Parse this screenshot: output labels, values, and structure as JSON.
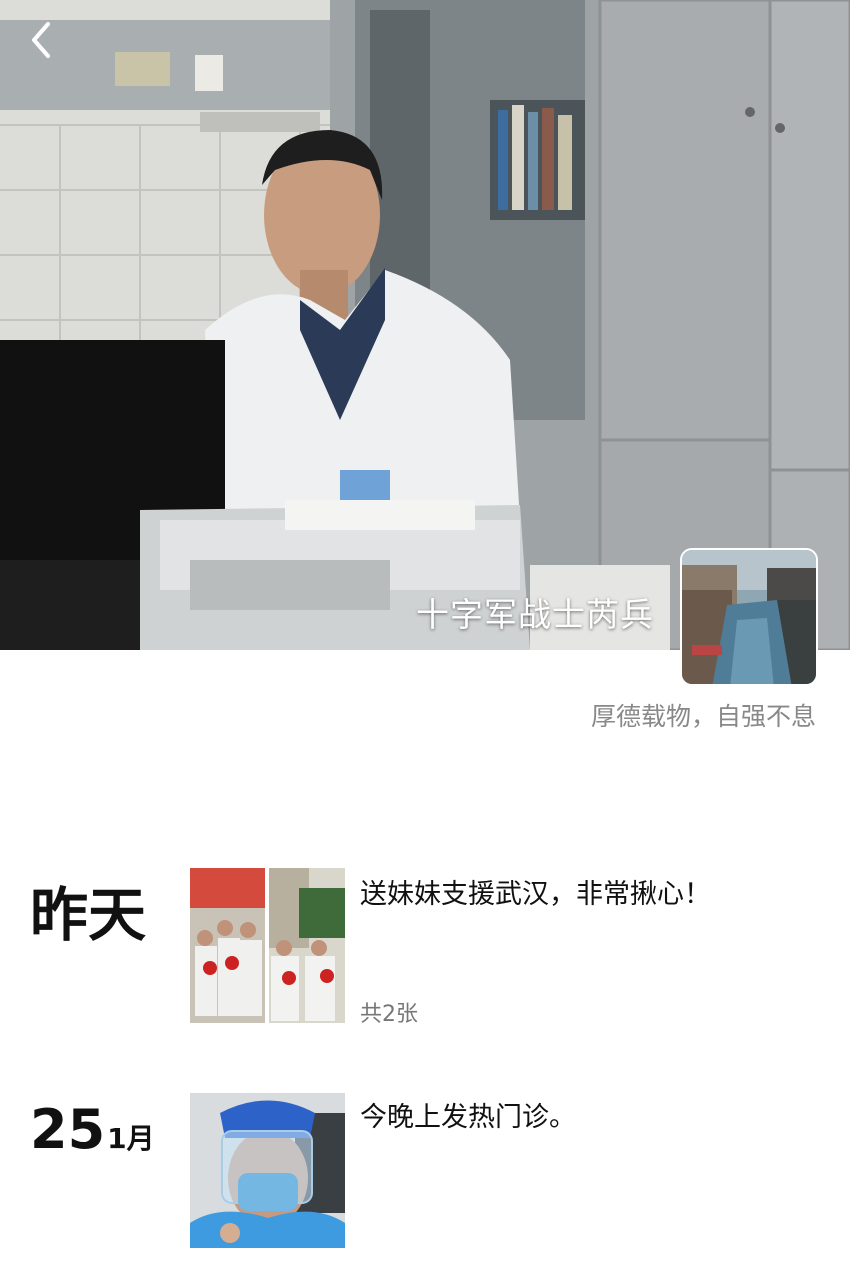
{
  "header": {
    "back_icon": "chevron-left-icon",
    "nickname": "十字军战士芮兵",
    "signature": "厚德载物，自强不息"
  },
  "cover": {
    "description_icon": "cover-photo"
  },
  "avatar": {
    "icon": "avatar-canal-photo"
  },
  "feed": [
    {
      "day": "昨天",
      "text": "送妹妹支援武汉，非常揪心！",
      "count": "共2张"
    },
    {
      "day_num": "25",
      "month": "1月",
      "text": "今晚上发热门诊。"
    }
  ],
  "colors": {
    "background": "#ffffff",
    "signature": "#888888",
    "nickname": "#ffffff"
  }
}
